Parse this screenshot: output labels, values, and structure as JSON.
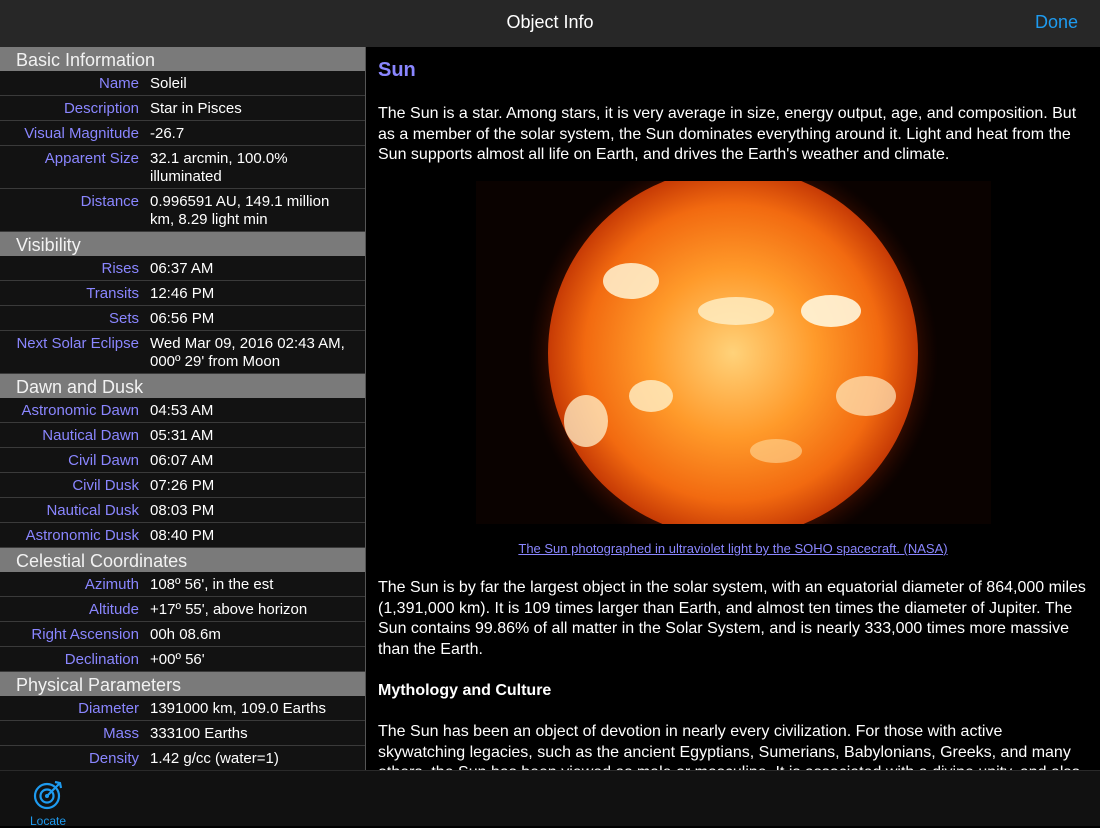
{
  "nav": {
    "title": "Object Info",
    "done_label": "Done"
  },
  "left": {
    "basic": {
      "header": "Basic Information",
      "rows": [
        {
          "k": "Name",
          "v": "Soleil"
        },
        {
          "k": "Description",
          "v": "Star in Pisces"
        },
        {
          "k": "Visual Magnitude",
          "v": "-26.7"
        },
        {
          "k": "Apparent Size",
          "v": "32.1 arcmin, 100.0% illuminated"
        },
        {
          "k": "Distance",
          "v": "0.996591 AU, 149.1 million km, 8.29 light min"
        }
      ]
    },
    "visibility": {
      "header": "Visibility",
      "rows": [
        {
          "k": "Rises",
          "v": "06:37 AM"
        },
        {
          "k": "Transits",
          "v": "12:46 PM"
        },
        {
          "k": "Sets",
          "v": "06:56 PM"
        },
        {
          "k": "Next Solar Eclipse",
          "v": "Wed Mar 09, 2016  02:43 AM, 000º 29' from Moon"
        }
      ]
    },
    "dawn": {
      "header": "Dawn and Dusk",
      "rows": [
        {
          "k": "Astronomic Dawn",
          "v": "04:53 AM"
        },
        {
          "k": "Nautical Dawn",
          "v": "05:31 AM"
        },
        {
          "k": "Civil Dawn",
          "v": "06:07 AM"
        },
        {
          "k": "Civil Dusk",
          "v": "07:26 PM"
        },
        {
          "k": "Nautical Dusk",
          "v": "08:03 PM"
        },
        {
          "k": "Astronomic Dusk",
          "v": "08:40 PM"
        }
      ]
    },
    "coords": {
      "header": "Celestial Coordinates",
      "rows": [
        {
          "k": "Azimuth",
          "v": "108º 56', in the est"
        },
        {
          "k": "Altitude",
          "v": "+17º 55', above horizon"
        },
        {
          "k": "Right Ascension",
          "v": "00h 08.6m"
        },
        {
          "k": "Declination",
          "v": "+00º 56'"
        }
      ]
    },
    "physical": {
      "header": "Physical Parameters",
      "rows": [
        {
          "k": "Diameter",
          "v": "1391000 km, 109.0 Earths"
        },
        {
          "k": "Mass",
          "v": "333100 Earths"
        },
        {
          "k": "Density",
          "v": "1.42 g/cc (water=1)"
        }
      ]
    }
  },
  "right": {
    "heading": "Sun",
    "intro": "The Sun is a star. Among stars, it is very average in size, energy output, age, and composition. But as a member of the solar system, the Sun dominates everything around it. Light and heat from the Sun supports almost all life on Earth, and drives the Earth's weather and climate.",
    "caption": "The Sun photographed in ultraviolet light by the SOHO spacecraft. (NASA)",
    "para2": "The Sun is by far the largest object in the solar system, with an equatorial diameter of 864,000 miles (1,391,000 km). It is 109 times larger than Earth, and almost ten times the diameter of Jupiter. The Sun contains 99.86% of all matter in the Solar System, and is nearly 333,000 times more massive than the Earth.",
    "subhead": "Mythology and Culture",
    "para3": "The Sun has been an object of devotion in nearly every civilization. For those with active skywatching legacies, such as the ancient Egyptians, Sumerians, Babylonians, Greeks, and many others, the Sun has been viewed as male or masculine. It is associated with a divine unity, and also"
  },
  "toolbar": {
    "locate_label": "Locate",
    "locate_icon": "locate-icon"
  },
  "colors": {
    "accent": "#1e9bf0",
    "label": "#8a86ff",
    "section_bg": "#7a7a7a"
  }
}
